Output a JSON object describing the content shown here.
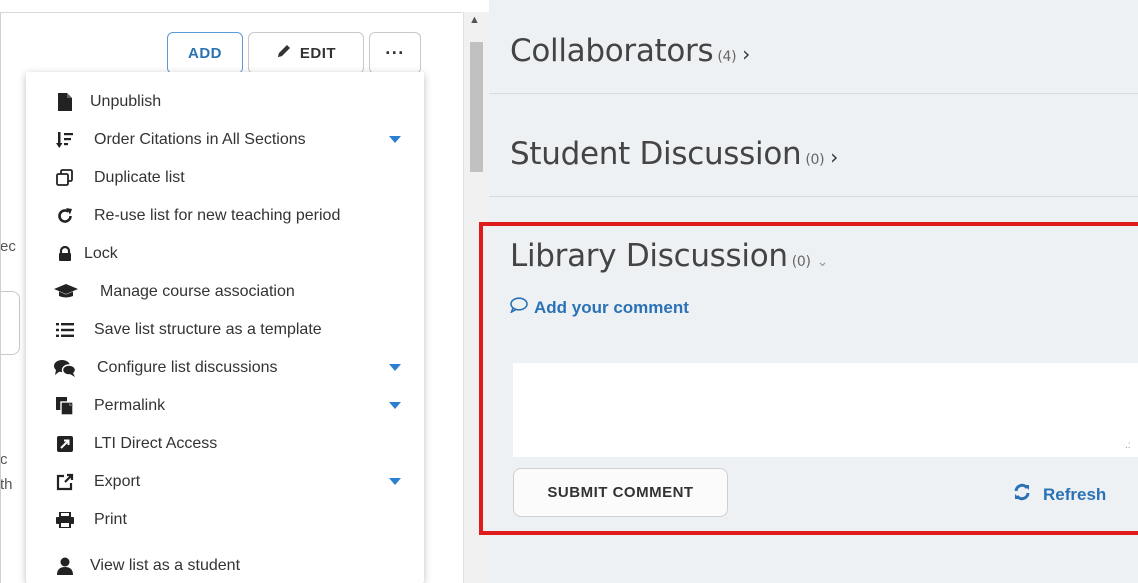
{
  "toolbar": {
    "add_label": "ADD",
    "edit_label": "EDIT",
    "more_label": "···"
  },
  "left_fragments": {
    "frag_ed": "ec",
    "frag_c": "c",
    "frag_th": "th"
  },
  "menu": {
    "items": [
      {
        "label": "Unpublish",
        "icon": "file-icon"
      },
      {
        "label": "Order Citations in All Sections",
        "icon": "sort-icon",
        "has_submenu": true
      },
      {
        "label": "Duplicate list",
        "icon": "duplicate-icon"
      },
      {
        "label": "Re-use list for new teaching period",
        "icon": "refresh-icon"
      },
      {
        "label": "Lock",
        "icon": "lock-icon"
      },
      {
        "label": "Manage course association",
        "icon": "graduation-cap-icon"
      },
      {
        "label": "Save list structure as a template",
        "icon": "list-icon"
      },
      {
        "label": "Configure list discussions",
        "icon": "comments-icon",
        "has_submenu": true
      },
      {
        "label": "Permalink",
        "icon": "copy-icon",
        "has_submenu": true
      },
      {
        "label": "LTI Direct Access",
        "icon": "external-square-icon"
      },
      {
        "label": "Export",
        "icon": "export-icon",
        "has_submenu": true
      },
      {
        "label": "Print",
        "icon": "print-icon"
      },
      {
        "label": "View list as a student",
        "icon": "user-icon"
      }
    ]
  },
  "sections": {
    "collaborators": {
      "title": "Collaborators",
      "count": "(4)"
    },
    "student_discussion": {
      "title": "Student Discussion",
      "count": "(0)"
    },
    "library_discussion": {
      "title": "Library Discussion",
      "count": "(0)"
    }
  },
  "comment": {
    "add_label": "Add your comment",
    "textarea_value": "",
    "submit_label": "SUBMIT COMMENT",
    "refresh_label": "Refresh"
  },
  "colors": {
    "accent": "#2a72b5",
    "highlight": "#e01b1b",
    "panel_bg": "#eef1f4"
  }
}
